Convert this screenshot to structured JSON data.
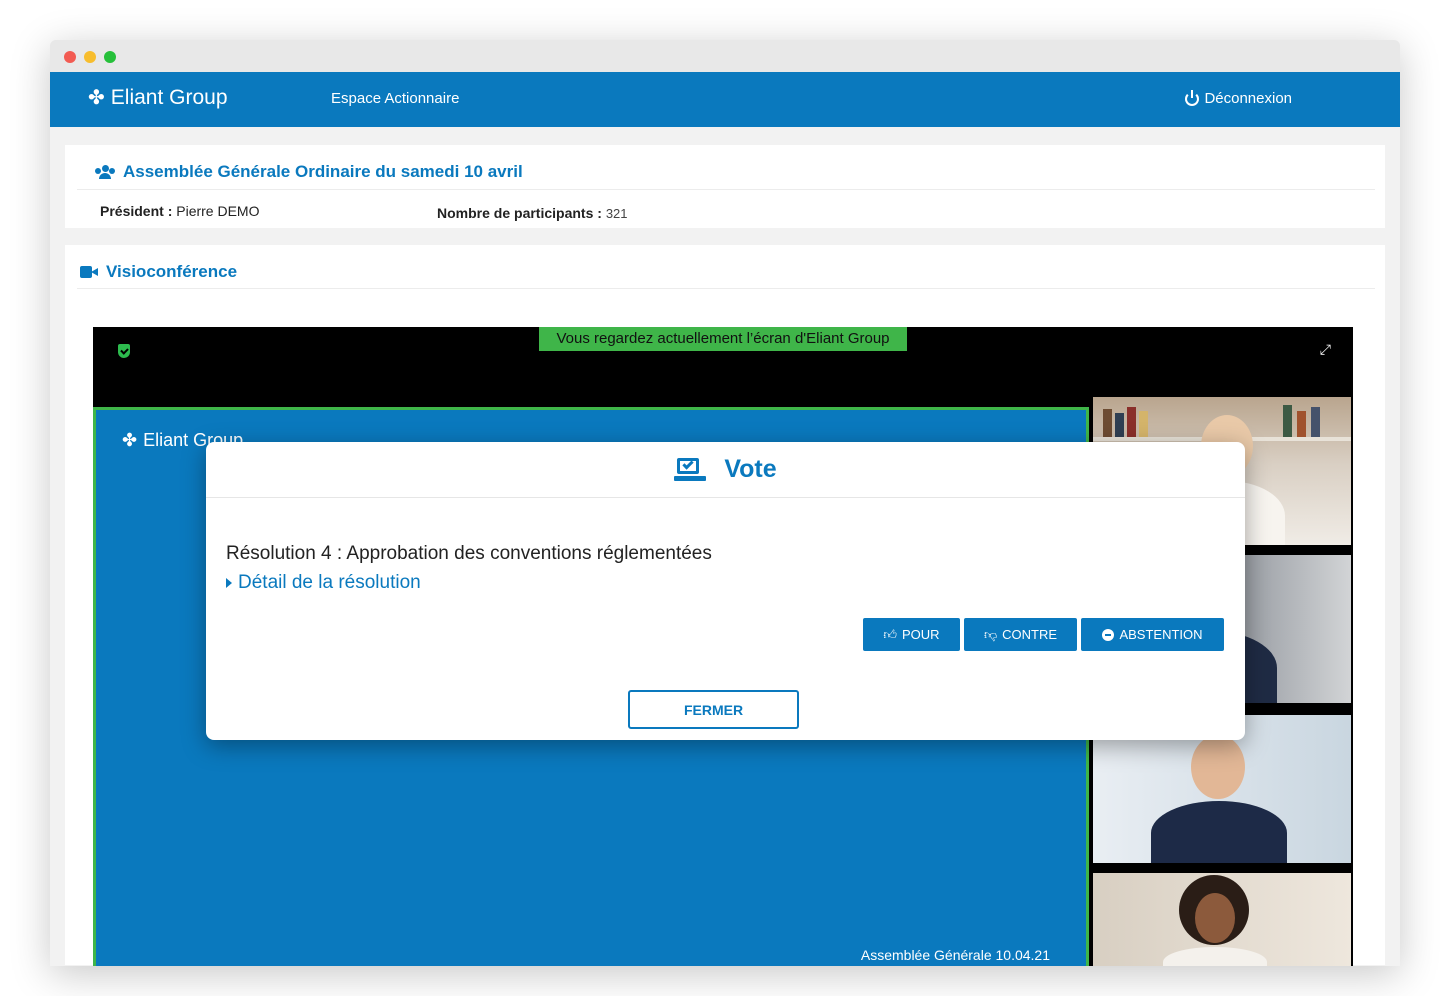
{
  "navbar": {
    "brand": "Eliant Group",
    "brand_icon": "puzzle-icon",
    "link": "Espace Actionnaire",
    "logout": "Déconnexion",
    "color": "#0a79be"
  },
  "meeting": {
    "title": "Assemblée Générale Ordinaire du samedi 10 avril",
    "president_label": "Président :",
    "president_value": "Pierre DEMO",
    "participants_label": "Nombre de participants :",
    "participants_value": "321"
  },
  "video": {
    "section_title": "Visioconférence",
    "banner": "Vous regardez actuellement l’écran d'Eliant Group",
    "screen_brand": "Eliant Group",
    "screen_footer": "Assemblée Générale 10.04.21",
    "banner_color": "#3fb549"
  },
  "vote_modal": {
    "title": "Vote",
    "resolution": "Résolution 4 : Approbation des conventions réglementées",
    "detail_link": "Détail de la résolution",
    "pour": "POUR",
    "contre": "CONTRE",
    "abstention": "ABSTENTION",
    "close": "FERMER"
  }
}
